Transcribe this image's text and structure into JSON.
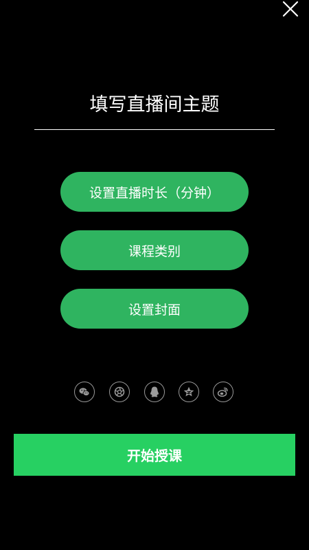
{
  "header": {
    "close_icon": "close-icon"
  },
  "title_input": {
    "placeholder": "填写直播间主题",
    "value": ""
  },
  "options": [
    {
      "label": "设置直播时长（分钟）"
    },
    {
      "label": "课程类别"
    },
    {
      "label": "设置封面"
    }
  ],
  "share_icons": [
    "wechat-icon",
    "moments-icon",
    "qq-icon",
    "qzone-icon",
    "weibo-icon"
  ],
  "start_button": {
    "label": "开始授课"
  },
  "colors": {
    "background": "#000000",
    "option_button": "#2fb460",
    "start_button": "#27d062",
    "share_icon_stroke": "#9a9a9a"
  }
}
